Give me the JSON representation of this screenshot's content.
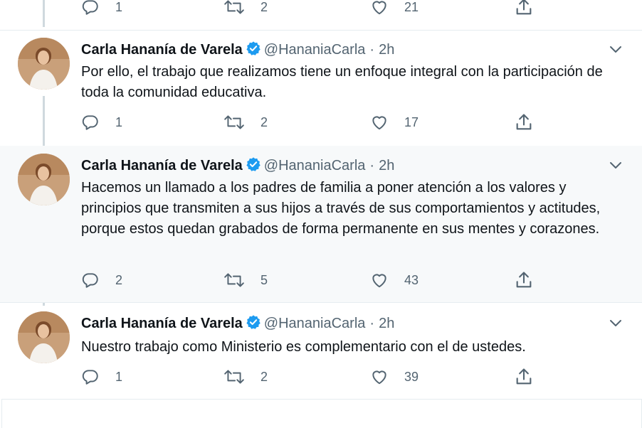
{
  "top_tweet_actions": {
    "replies": "1",
    "retweets": "2",
    "likes": "21"
  },
  "tweets": [
    {
      "name": "Carla Hananía de Varela",
      "handle": "@HananiaCarla",
      "separator": "·",
      "time": "2h",
      "text": "Por ello, el trabajo que realizamos tiene un enfoque integral con la participación de toda la comunidad educativa.",
      "replies": "1",
      "retweets": "2",
      "likes": "17"
    },
    {
      "name": "Carla Hananía de Varela",
      "handle": "@HananiaCarla",
      "separator": "·",
      "time": "2h",
      "text": "Hacemos un llamado a los padres de familia a poner atención a los valores y principios que transmiten a sus hijos a través de sus comportamientos y actitudes, porque estos quedan grabados de forma permanente en sus mentes y corazones.",
      "replies": "2",
      "retweets": "5",
      "likes": "43"
    },
    {
      "name": "Carla Hananía de Varela",
      "handle": "@HananiaCarla",
      "separator": "·",
      "time": "2h",
      "text": "Nuestro trabajo como Ministerio es complementario con el de ustedes.",
      "replies": "1",
      "retweets": "2",
      "likes": "39"
    }
  ],
  "colors": {
    "verified": "#1d9bf0",
    "secondary": "#536471",
    "thread_line": "#cfd9de"
  },
  "icons": [
    "reply-icon",
    "retweet-icon",
    "like-icon",
    "share-icon",
    "verified-badge-icon",
    "chevron-down-icon"
  ]
}
